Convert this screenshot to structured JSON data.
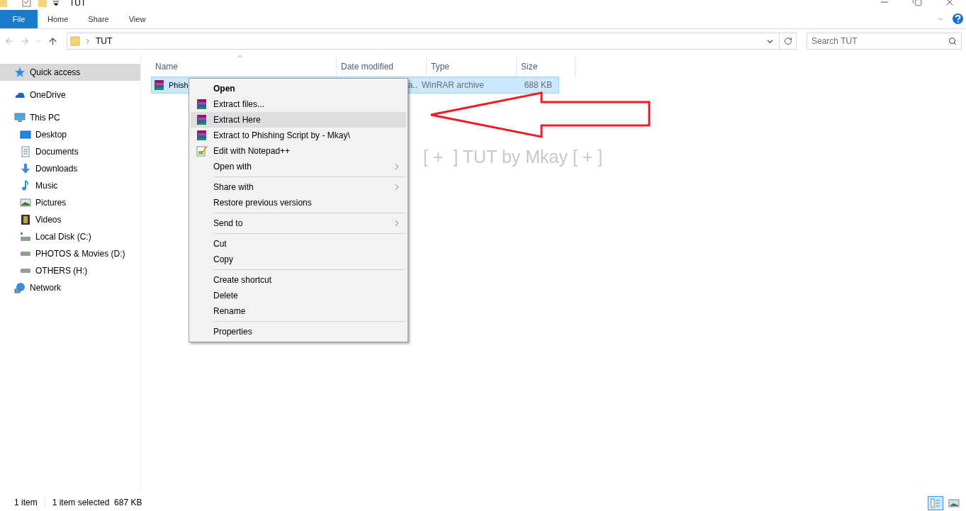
{
  "window": {
    "title": "TUT"
  },
  "ribbon_tabs": [
    {
      "label": "File",
      "kind": "file",
      "selected": false
    },
    {
      "label": "Home",
      "kind": "tab",
      "selected": false
    },
    {
      "label": "Share",
      "kind": "tab",
      "selected": false
    },
    {
      "label": "View",
      "kind": "tab",
      "selected": false
    }
  ],
  "address": {
    "path": [
      "TUT"
    ]
  },
  "search": {
    "placeholder": "Search TUT"
  },
  "sidebar": {
    "items": [
      {
        "label": "Quick access",
        "kind": "star",
        "selected": true
      },
      {
        "label": "OneDrive",
        "kind": "cloud",
        "selected": false
      },
      {
        "label": "This PC",
        "kind": "pc",
        "selected": false,
        "children": [
          {
            "label": "Desktop",
            "kind": "desktop",
            "selected": false
          },
          {
            "label": "Documents",
            "kind": "document",
            "selected": false
          },
          {
            "label": "Downloads",
            "kind": "download",
            "selected": false
          },
          {
            "label": "Music",
            "kind": "music",
            "selected": false
          },
          {
            "label": "Pictures",
            "kind": "picture",
            "selected": false
          },
          {
            "label": "Videos",
            "kind": "video",
            "selected": false
          },
          {
            "label": "Local Disk (C:)",
            "kind": "sysdrive",
            "selected": false
          },
          {
            "label": "PHOTOS & Movies (D:)",
            "kind": "drive",
            "selected": false
          },
          {
            "label": "OTHERS (H:)",
            "kind": "drive",
            "selected": false
          }
        ]
      },
      {
        "label": "Network",
        "kind": "network",
        "selected": false
      }
    ]
  },
  "table": {
    "columns": [
      "Name",
      "Date modified",
      "Type",
      "Size"
    ],
    "rows": [
      {
        "name": "Phish",
        "date_modified": "a..",
        "type": "WinRAR archive",
        "size": "688 KB",
        "selected": true
      }
    ]
  },
  "context_menu": {
    "groups": [
      [
        {
          "label": "Open",
          "kind": "plain",
          "bold": true,
          "submenu": false,
          "selected": false
        },
        {
          "label": "Extract files...",
          "kind": "archive",
          "bold": false,
          "submenu": false,
          "selected": false
        },
        {
          "label": "Extract Here",
          "kind": "archive",
          "bold": false,
          "submenu": false,
          "selected": true
        },
        {
          "label": "Extract to Phishing Script by - Mkay\\",
          "kind": "archive",
          "bold": false,
          "submenu": false,
          "selected": false
        },
        {
          "label": "Edit with Notepad++",
          "kind": "notepad",
          "bold": false,
          "submenu": false,
          "selected": false
        },
        {
          "label": "Open with",
          "kind": "plain",
          "bold": false,
          "submenu": true,
          "selected": false
        }
      ],
      [
        {
          "label": "Share with",
          "kind": "plain",
          "bold": false,
          "submenu": true,
          "selected": false
        },
        {
          "label": "Restore previous versions",
          "kind": "plain",
          "bold": false,
          "submenu": false,
          "selected": false
        }
      ],
      [
        {
          "label": "Send to",
          "kind": "plain",
          "bold": false,
          "submenu": true,
          "selected": false
        }
      ],
      [
        {
          "label": "Cut",
          "kind": "plain",
          "bold": false,
          "submenu": false,
          "selected": false
        },
        {
          "label": "Copy",
          "kind": "plain",
          "bold": false,
          "submenu": false,
          "selected": false
        }
      ],
      [
        {
          "label": "Create shortcut",
          "kind": "plain",
          "bold": false,
          "submenu": false,
          "selected": false
        },
        {
          "label": "Delete",
          "kind": "plain",
          "bold": false,
          "submenu": false,
          "selected": false
        },
        {
          "label": "Rename",
          "kind": "plain",
          "bold": false,
          "submenu": false,
          "selected": false
        }
      ],
      [
        {
          "label": "Properties",
          "kind": "plain",
          "bold": false,
          "submenu": false,
          "selected": false
        }
      ]
    ]
  },
  "overlay_caption": "[ +  ] TUT by Mkay [ + ]",
  "status_bar": {
    "items": [
      "1 item",
      "1 item selected  687 KB"
    ],
    "view_modes": [
      {
        "kind": "details",
        "selected": true
      },
      {
        "kind": "thumbnails",
        "selected": false
      }
    ]
  }
}
